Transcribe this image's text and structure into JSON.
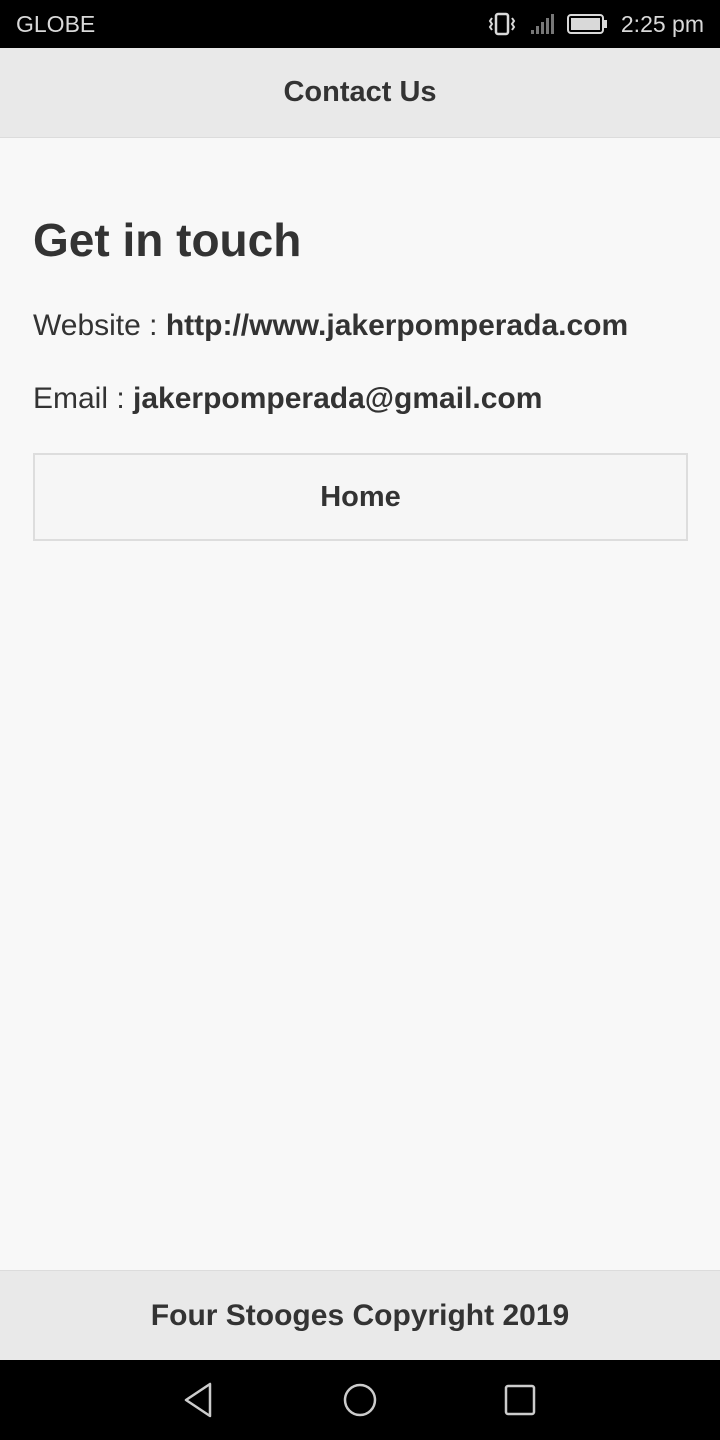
{
  "status_bar": {
    "carrier": "GLOBE",
    "time": "2:25 pm",
    "icons": [
      "vibrate-icon",
      "signal-icon",
      "battery-icon"
    ]
  },
  "header": {
    "title": "Contact Us"
  },
  "main": {
    "heading": "Get in touch",
    "website_label": "Website : ",
    "website_value": "http://www.jakerpomperada.com",
    "email_label": "Email : ",
    "email_value": "jakerpomperada@gmail.com",
    "home_button": "Home"
  },
  "footer": {
    "text": "Four Stooges Copyright 2019"
  },
  "nav_bar": {
    "icons": [
      "back-icon",
      "home-icon",
      "recents-icon"
    ]
  },
  "colors": {
    "header_bg": "#e9e9e9",
    "page_bg": "#f8f8f8",
    "text": "#333333",
    "system_bar": "#000000"
  }
}
